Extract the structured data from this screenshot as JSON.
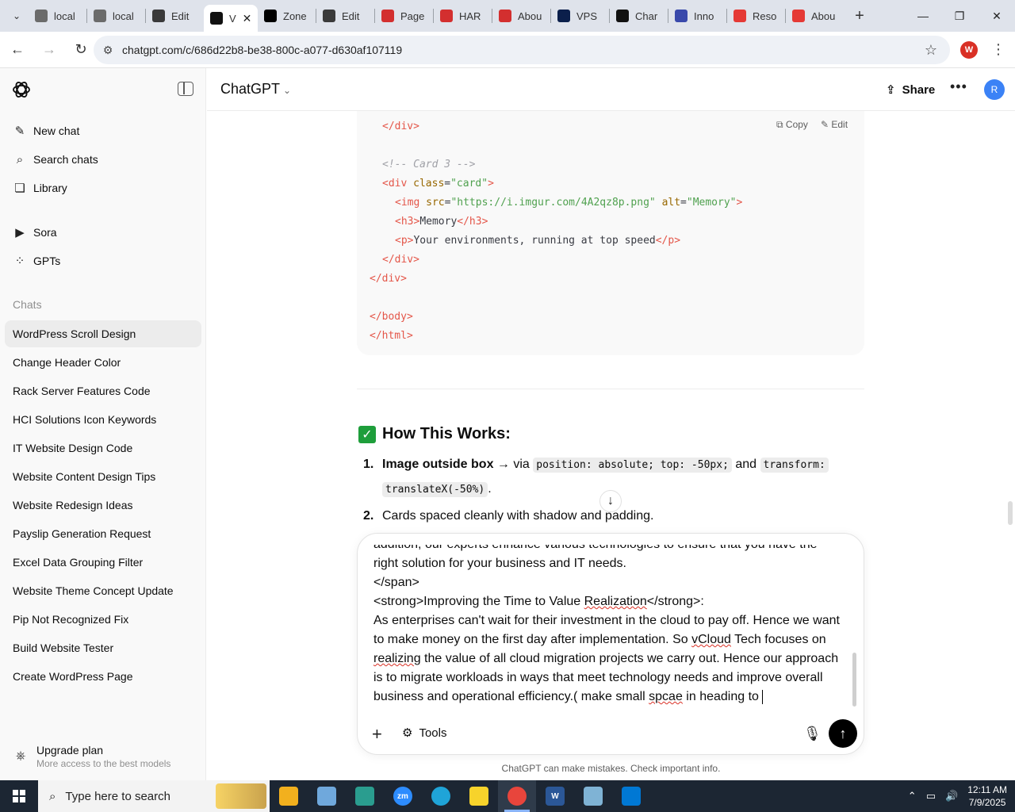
{
  "browser": {
    "tabs": [
      {
        "label": "local",
        "fav": "db-icon",
        "color": "#6b6b6b"
      },
      {
        "label": "local",
        "fav": "db-icon",
        "color": "#6b6b6b"
      },
      {
        "label": "Edit",
        "fav": "wordpress-icon",
        "color": "#3a3a3a"
      },
      {
        "label": "V",
        "fav": "openai-icon",
        "color": "#111111",
        "active": true
      },
      {
        "label": "Zone",
        "fav": "z-icon",
        "color": "#000000"
      },
      {
        "label": "Edit",
        "fav": "wordpress-icon",
        "color": "#3a3a3a"
      },
      {
        "label": "Page",
        "fav": "diamond-icon",
        "color": "#d32f2f"
      },
      {
        "label": "HAR",
        "fav": "diamond-icon",
        "color": "#d32f2f"
      },
      {
        "label": "Abou",
        "fav": "diamond-icon",
        "color": "#d32f2f"
      },
      {
        "label": "VPS",
        "fav": "v-icon",
        "color": "#0b1f4b"
      },
      {
        "label": "Char",
        "fav": "openai-icon",
        "color": "#111111"
      },
      {
        "label": "Inno",
        "fav": "swirl-icon",
        "color": "#3949ab"
      },
      {
        "label": "Reso",
        "fav": "slash-icon",
        "color": "#e53935"
      },
      {
        "label": "Abou",
        "fav": "slash-icon",
        "color": "#e53935"
      }
    ],
    "url": "chatgpt.com/c/686d22b8-be38-800c-a077-d630af107119",
    "profile_initial": "W"
  },
  "sidebar": {
    "top_items": [
      {
        "label": "New chat",
        "icon": "edit-icon"
      },
      {
        "label": "Search chats",
        "icon": "search-icon"
      },
      {
        "label": "Library",
        "icon": "library-icon"
      },
      {
        "label": "Sora",
        "icon": "play-icon"
      },
      {
        "label": "GPTs",
        "icon": "grid-icon"
      }
    ],
    "chats_label": "Chats",
    "chats": [
      "WordPress Scroll Design",
      "Change Header Color",
      "Rack Server Features Code",
      "HCI Solutions Icon Keywords",
      "IT Website Design Code",
      "Website Content Design Tips",
      "Website Redesign Ideas",
      "Payslip Generation Request",
      "Excel Data Grouping Filter",
      "Website Theme Concept Update",
      "Pip Not Recognized Fix",
      "Build Website Tester",
      "Create WordPress Page"
    ],
    "upgrade_title": "Upgrade plan",
    "upgrade_sub": "More access to the best models"
  },
  "header": {
    "model": "ChatGPT",
    "share": "Share",
    "avatar": "R"
  },
  "code": {
    "copy": "Copy",
    "edit": "Edit",
    "lines": [
      {
        "indent": 2,
        "parts": [
          [
            "tg",
            "</div>"
          ]
        ]
      },
      {
        "indent": 0,
        "parts": []
      },
      {
        "indent": 2,
        "parts": [
          [
            "cm",
            "<!-- Card 3 -->"
          ]
        ]
      },
      {
        "indent": 2,
        "parts": [
          [
            "tg",
            "<div "
          ],
          [
            "at",
            "class"
          ],
          [
            "",
            "="
          ],
          [
            "st",
            "\"card\""
          ],
          [
            "tg",
            ">"
          ]
        ]
      },
      {
        "indent": 4,
        "parts": [
          [
            "tg",
            "<img "
          ],
          [
            "at",
            "src"
          ],
          [
            "",
            "="
          ],
          [
            "st",
            "\"https://i.imgur.com/4A2qz8p.png\""
          ],
          [
            "",
            " "
          ],
          [
            "at",
            "alt"
          ],
          [
            "",
            "="
          ],
          [
            "st",
            "\"Memory\""
          ],
          [
            "tg",
            ">"
          ]
        ]
      },
      {
        "indent": 4,
        "parts": [
          [
            "tg",
            "<h3>"
          ],
          [
            "",
            "Memory"
          ],
          [
            "tg",
            "</h3>"
          ]
        ]
      },
      {
        "indent": 4,
        "parts": [
          [
            "tg",
            "<p>"
          ],
          [
            "",
            "Your environments, running at top speed"
          ],
          [
            "tg",
            "</p>"
          ]
        ]
      },
      {
        "indent": 2,
        "parts": [
          [
            "tg",
            "</div>"
          ]
        ]
      },
      {
        "indent": 0,
        "parts": [
          [
            "tg",
            "</div>"
          ]
        ]
      },
      {
        "indent": 0,
        "parts": []
      },
      {
        "indent": 0,
        "parts": [
          [
            "tg",
            "</body>"
          ]
        ]
      },
      {
        "indent": 0,
        "parts": [
          [
            "tg",
            "</html>"
          ]
        ]
      }
    ]
  },
  "explain": {
    "title": "How This Works:",
    "item1_num": "1.",
    "item1_bold": "Image outside box",
    "item1_mid": " → via ",
    "item1_code1": "position: absolute; top: -50px;",
    "item1_and": " and ",
    "item1_code2": "transform:",
    "item1_code3": "translateX(-50%)",
    "item1_end": ".",
    "item2_num": "2.",
    "item2_text": "Cards spaced cleanly with shadow and padding."
  },
  "composer": {
    "lines": [
      "addition, our experts enhance various technologies to ensure that you have the",
      "right solution for your business and IT needs.",
      "</span>",
      "<strong>Improving the Time to Value Realization</strong>:",
      "As enterprises can't wait for their investment in the cloud to pay off. Hence we want",
      "to make money on the first day after implementation. So vCloud Tech focuses on",
      "realizing the value of all cloud migration projects we carry out. Hence our approach",
      "is to migrate workloads in ways that meet technology needs and improve overall",
      "business and operational efficiency.( make small spcae in heading to "
    ],
    "tools": "Tools"
  },
  "disclaimer": "ChatGPT can make mistakes. Check important info.",
  "taskbar": {
    "search_placeholder": "Type here to search",
    "time": "12:11 AM",
    "date": "7/9/2025"
  }
}
